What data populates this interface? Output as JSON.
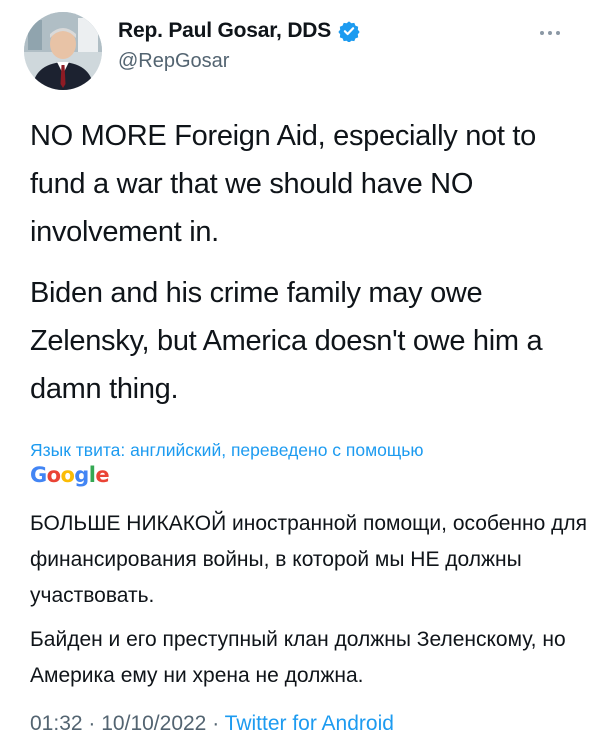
{
  "author": {
    "name": "Rep. Paul Gosar, DDS",
    "handle": "@RepGosar",
    "verified": true,
    "avatar_icon": "profile-photo"
  },
  "tweet": {
    "paragraphs": [
      "NO MORE Foreign Aid, especially not to fund a war that we should have NO involvement in.",
      "Biden and his crime family may owe Zelensky, but America doesn't owe him a damn thing."
    ]
  },
  "translation": {
    "label": "Язык твита: английский, переведено с помощью",
    "provider": "Google",
    "paragraphs": [
      "БОЛЬШЕ НИКАКОЙ иностранной помощи, особенно для финансирования войны, в которой мы НЕ должны участвовать.",
      "Байден и его преступный клан должны Зеленскому, но Америка ему ни хрена не должна."
    ]
  },
  "meta": {
    "time": "01:32",
    "separator": "·",
    "date": "10/10/2022",
    "source": "Twitter for Android"
  },
  "colors": {
    "link": "#1d9bf0",
    "secondary_text": "#536471",
    "verified_badge": "#1d9bf0"
  }
}
